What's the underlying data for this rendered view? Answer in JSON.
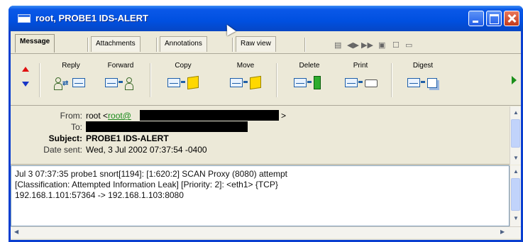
{
  "window": {
    "title": "root, PROBE1 IDS-ALERT",
    "controls": [
      "minimize",
      "maximize",
      "close"
    ]
  },
  "tabs": [
    {
      "label": "Message",
      "active": true
    },
    {
      "label": "Attachments",
      "active": false
    },
    {
      "label": "Annotations",
      "active": false
    },
    {
      "label": "Raw view",
      "active": false
    }
  ],
  "toolbar": {
    "buttons": [
      {
        "label": "Reply",
        "icon": "reply-icon"
      },
      {
        "label": "Forward",
        "icon": "forward-icon"
      },
      {
        "label": "Copy",
        "icon": "copy-icon"
      },
      {
        "label": "Move",
        "icon": "move-icon"
      },
      {
        "label": "Delete",
        "icon": "delete-icon"
      },
      {
        "label": "Print",
        "icon": "print-icon"
      },
      {
        "label": "Digest",
        "icon": "digest-icon"
      }
    ]
  },
  "headers": {
    "from_label": "From:",
    "from_name": "root <",
    "from_link": "root@",
    "from_end": ">",
    "to_label": "To:",
    "subject_label": "Subject:",
    "subject": "PROBE1 IDS-ALERT",
    "date_label": "Date sent:",
    "date": "Wed, 3 Jul 2002 07:37:54 -0400"
  },
  "body": {
    "lines": [
      "Jul 3 07:37:35 probe1 snort[1194]: [1:620:2] SCAN Proxy (8080) attempt",
      "[Classification: Attempted Information Leak] [Priority: 2]: <eth1> {TCP}",
      "192.168.1.101:57364 -> 192.168.1.103:8080"
    ]
  },
  "colors": {
    "titlebar": "#0050e0",
    "chrome": "#ece9d8",
    "link": "#1b8a1b",
    "prev_arrow": "#e01010",
    "next_arrow": "#1836c6"
  }
}
